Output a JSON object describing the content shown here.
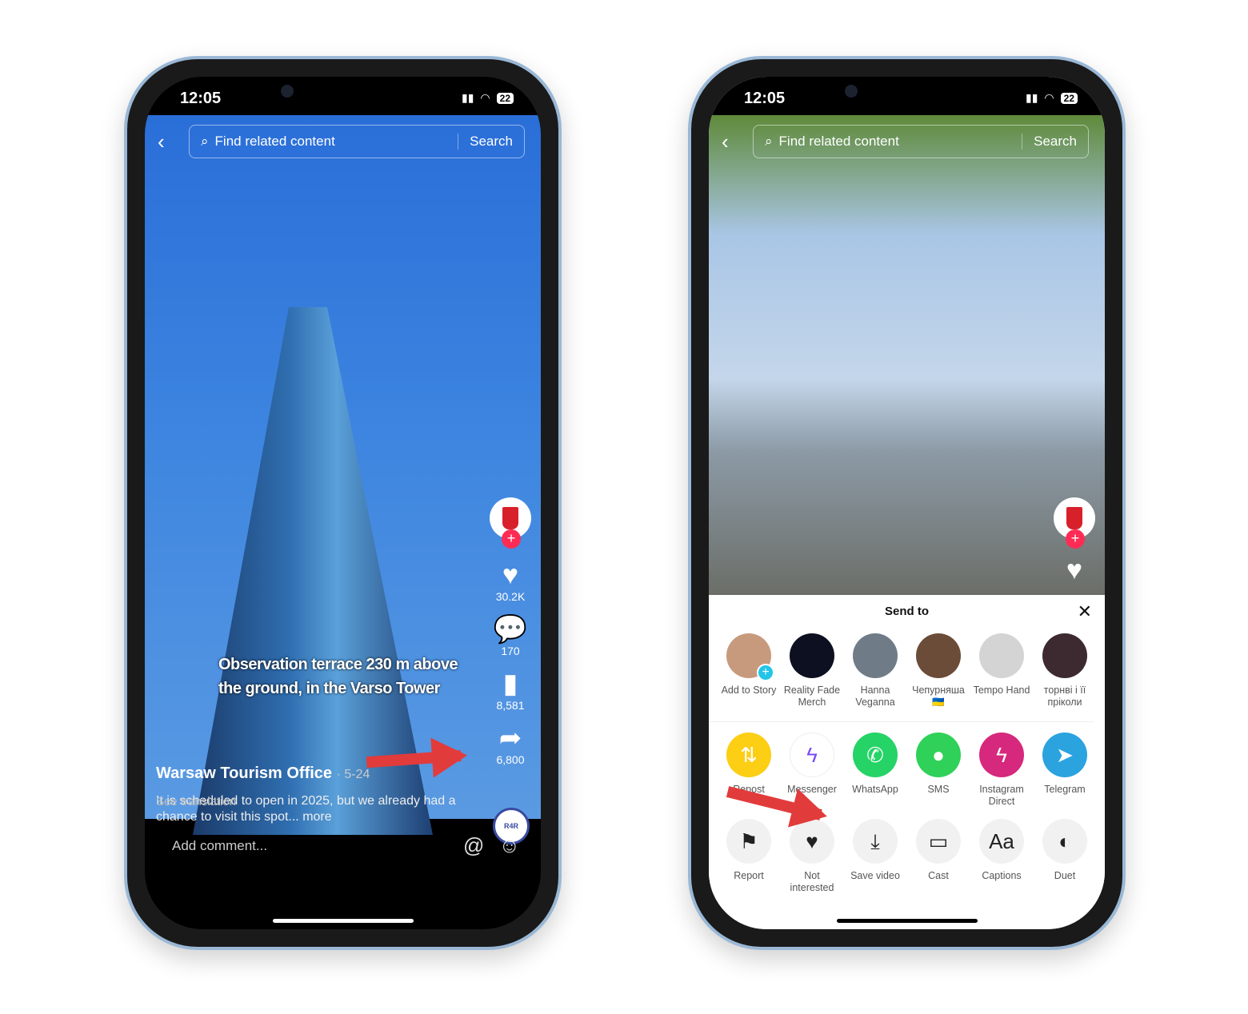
{
  "status": {
    "time": "12:05",
    "battery": "22"
  },
  "search": {
    "placeholder": "Find related content",
    "button": "Search"
  },
  "left": {
    "caption_line1": "Observation terrace 230 m above",
    "caption_line2": "the ground, in the Varso Tower",
    "author": "Warsaw Tourism Office",
    "date": "· 5-24",
    "description": "It is scheduled to open in 2025, but we already had a chance to visit this spot... more",
    "see_translation": "See translation",
    "likes": "30.2K",
    "comments": "170",
    "saves": "8,581",
    "shares": "6,800",
    "music_label": "R4R",
    "comment_placeholder": "Add comment..."
  },
  "sheet": {
    "title": "Send to",
    "contacts": [
      {
        "name": "Add to Story",
        "color": "#c79a7e"
      },
      {
        "name": "Reality Fade Merch",
        "color": "#0d1020"
      },
      {
        "name": "Hanna Veganna",
        "color": "#6f7c88"
      },
      {
        "name": "Чепурняша 🇺🇦",
        "color": "#6b4c38"
      },
      {
        "name": "Tempo Hand",
        "color": "#d4d4d4"
      },
      {
        "name": "торнві і її пріколи",
        "color": "#3c2a30"
      }
    ],
    "apps": [
      {
        "name": "Repost",
        "icon": "repost-icon",
        "glyph": "⇅",
        "color": "#fcce14"
      },
      {
        "name": "Messenger",
        "icon": "messenger-icon",
        "glyph": "ϟ",
        "color": "#ffffff"
      },
      {
        "name": "WhatsApp",
        "icon": "whatsapp-icon",
        "glyph": "✆",
        "color": "#25d366"
      },
      {
        "name": "SMS",
        "icon": "sms-icon",
        "glyph": "●",
        "color": "#2fd158"
      },
      {
        "name": "Instagram Direct",
        "icon": "instagram-direct-icon",
        "glyph": "ϟ",
        "color": "#d6287c"
      },
      {
        "name": "Telegram",
        "icon": "telegram-icon",
        "glyph": "➤",
        "color": "#2aa3df"
      }
    ],
    "actions": [
      {
        "name": "Report",
        "icon": "flag-icon",
        "glyph": "⚑"
      },
      {
        "name": "Not interested",
        "icon": "broken-heart-icon",
        "glyph": "♥"
      },
      {
        "name": "Save video",
        "icon": "download-icon",
        "glyph": "⤓"
      },
      {
        "name": "Cast",
        "icon": "cast-icon",
        "glyph": "▭"
      },
      {
        "name": "Captions",
        "icon": "captions-icon",
        "glyph": "Aa"
      },
      {
        "name": "Duet",
        "icon": "duet-icon",
        "glyph": "◐"
      }
    ]
  },
  "colors": {
    "accent": "#fe2c55",
    "arrow": "#e23b3b",
    "frame": "#9ab8d6"
  }
}
